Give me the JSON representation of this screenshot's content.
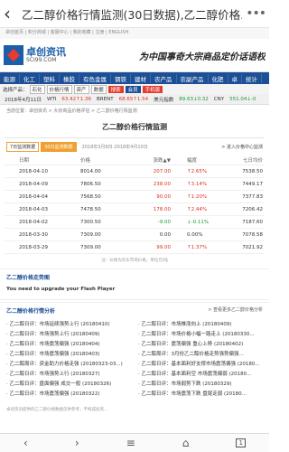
{
  "browser": {
    "back": "‹",
    "title": "乙二醇价格行情监测(30日数据),乙二醇价格...",
    "menu": "•••"
  },
  "toplinks": "卓创首页 | 积分商城 | 客服中心 | 我的收藏 | 注册 | ENGLISH",
  "brand": {
    "name": "卓创资讯",
    "domain": "SCI99.COM",
    "slogan": "为中国事奇大宗商品定价话语权"
  },
  "nav": [
    "能源",
    "化工",
    "塑料",
    "橡胶",
    "有色金属",
    "钢铁",
    "建材",
    "农产品",
    "农副产品",
    "化肥",
    "卓",
    "统计"
  ],
  "subnav": {
    "label": "选择产品：",
    "selects": [
      "石化",
      "价格行情"
    ],
    "selects2": [
      "资产",
      "数据"
    ],
    "btn1": "搜索",
    "btn2": "会员",
    "btn3": "手机版"
  },
  "ticker": {
    "date": "2018年4月11日",
    "wti_label": "WTI",
    "wti": "63.42↑1.36",
    "brent_label": "BRENT",
    "brent": "68.65↑1.54",
    "usd_label": "美元指数",
    "usd": "89.63↓0.32",
    "cny_label": "CNY",
    "cny": "551.04↓-0"
  },
  "breadcrumb": "当前位置：卓创资讯 > 大宗商品价格评估 > 乙二醇价格行情监测",
  "section_title": "乙二醇价格行情监测",
  "controls": {
    "tab1": "7日监测数据",
    "tab2": "30日监测数据",
    "dates": "2018年3月8日-2018年4月10日",
    "right": "> 进入价格中心监测"
  },
  "table": {
    "headers": [
      "日期",
      "价格",
      "涨跌▲▼",
      "幅度",
      "七日均价"
    ],
    "rows": [
      {
        "date": "2018-04-10",
        "price": "8014.00",
        "change": "207.00",
        "pct": "↑2.65%",
        "avg": "7538.50",
        "up": true
      },
      {
        "date": "2018-04-09",
        "price": "7806.50",
        "change": "238.00",
        "pct": "↑3.14%",
        "avg": "7449.17",
        "up": true
      },
      {
        "date": "2018-04-04",
        "price": "7568.50",
        "change": "90.00",
        "pct": "↑1.20%",
        "avg": "7377.83",
        "up": true
      },
      {
        "date": "2018-04-03",
        "price": "7478.50",
        "change": "178.00",
        "pct": "↑2.44%",
        "avg": "7206.42",
        "up": true
      },
      {
        "date": "2018-04-02",
        "price": "7300.50",
        "change": "-9.00",
        "pct": "↓-0.11%",
        "avg": "7187.60",
        "up": false
      },
      {
        "date": "2018-03-30",
        "price": "7309.00",
        "change": "0.00",
        "pct": "0.00%",
        "avg": "7078.58",
        "flat": true
      },
      {
        "date": "2018-03-29",
        "price": "7309.00",
        "change": "99.00",
        "pct": "↑1.37%",
        "avg": "7021.92",
        "up": true
      }
    ]
  },
  "table_note": "注：价格为华东市场价格，单位元/吨",
  "trend": {
    "title": "乙二醇价格走势图",
    "flash": "You need to upgrade your Flash Player"
  },
  "analysis": {
    "title": "乙二醇价格行情分析",
    "more": "> 查看更多乙二醇价格分析"
  },
  "news_left": [
    "· 乙二醇日评：市场延续强势上行 (20180410)",
    "· 乙二醇日评：市场强势上行 (20180409)",
    "· 乙二醇日评：市场震荡偏强 (20180404)",
    "· 乙二醇日评：市场震荡偏强 (20180403)",
    "· 乙二醇周评：资金助力价格走强 (20180323-03...)",
    "· 乙二醇日评：市场强势上行 (20180327)",
    "· 乙二醇日评：盘面偏强 成交一般 (20180326)",
    "· 乙二醇日评：市场震荡偏强 (20180322)"
  ],
  "news_right": [
    "· 乙二醇日评：市场推涨向上 (20180409)",
    "· 乙二醇日评：市场价格小幅一路走上 (20180330...",
    "· 乙二醇日评：震荡偏强 重心上移 (20180402)",
    "· 乙二醇周评：3月份乙二醇价格走势强势偏强...",
    "· 乙二醇日评：基本面利好支撑市场震荡偏强 (20180...",
    "· 乙二醇日评：基本面利空 市场震荡偏弱 (20180...",
    "· 乙二醇日评：市场弱势下跌 (20180329)",
    "· 乙二醇日评：市场震荡下跌 盘尾走弱 (20180..."
  ],
  "footer": "卓创资讯提供的乙二醇价格数据仅供参考，不构成投资…",
  "bottom": {
    "back": "‹",
    "forward": "›",
    "menu": "≡",
    "home": "⌂",
    "pages": "1"
  }
}
